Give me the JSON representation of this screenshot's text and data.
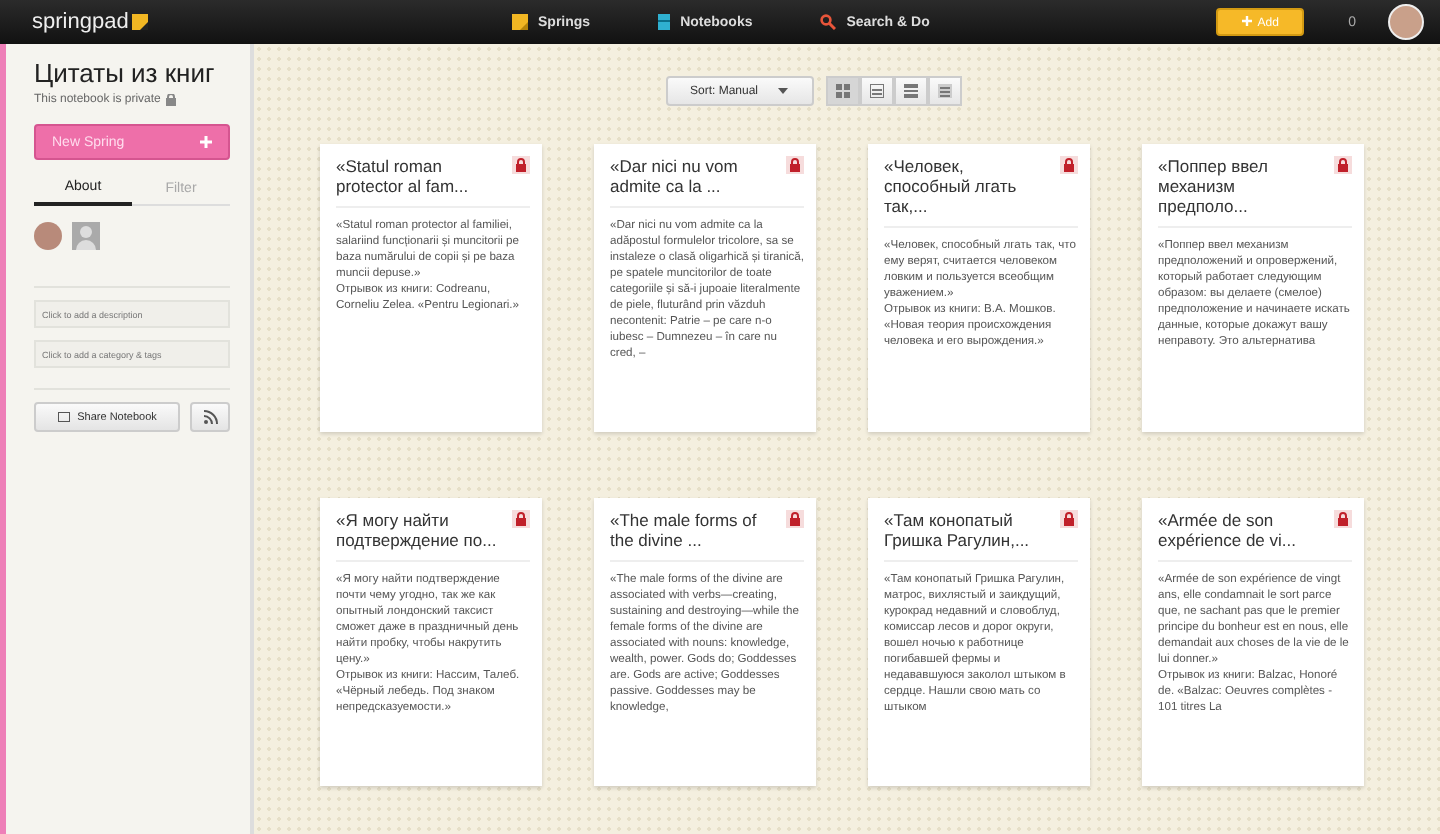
{
  "topbar": {
    "logo": "springpad",
    "nav": [
      {
        "label": "Springs",
        "kind": "springs"
      },
      {
        "label": "Notebooks",
        "kind": "notebooks"
      },
      {
        "label": "Search & Do",
        "kind": "search"
      }
    ],
    "add_button": "Add",
    "count": "0"
  },
  "sidebar": {
    "title": "Цитаты из книг",
    "privacy": "This notebook is private",
    "new_button": "New Spring",
    "tabs": [
      {
        "label": "About",
        "selected": true
      },
      {
        "label": "Filter",
        "selected": false
      }
    ],
    "description_placeholder": "Click to add a description",
    "tags_placeholder": "Click to add a category & tags",
    "share_button": "Share Notebook"
  },
  "toolbar": {
    "sort": "Sort: Manual",
    "view_modes": [
      {
        "kind": "grid",
        "selected": true
      },
      {
        "kind": "list",
        "selected": false
      },
      {
        "kind": "rows",
        "selected": false
      },
      {
        "kind": "compact",
        "selected": false
      }
    ]
  },
  "cards": [
    {
      "title": "«Statul roman protector al fam...",
      "quote": "«Statul roman protector al familiei, salariind funcționarii și muncitorii pe baza numărului de copii și pe baza muncii depuse.»",
      "source": "Отрывок из книги: Codreanu, Corneliu Zelea. «Pentru Legionari.»"
    },
    {
      "title": "«Dar nici nu vom admite ca la ...",
      "quote": "«Dar nici nu vom admite ca la adăpostul formulelor tricolore, sa se instaleze o clasă oligarhică și tiranică, pe spatele muncitorilor de toate categoriile și să-i jupoaie literalmente de piele, fluturând prin văzduh necontenit: Patrie – pe care n-o iubesc – Dumnezeu – în care nu cred, –"
    },
    {
      "title": "«Человек, способный лгать так,...",
      "quote": "«Человек, способный лгать так, что ему верят, считается человеком ловким и пользуется всеобщим уважением.»",
      "source": "Отрывок из книги: В.А. Мошков. «Новая теория происхождения человека и его вырождения.»"
    },
    {
      "title": "«Поппер ввел механизм предполо...",
      "quote": "«Поппер ввел механизм предположений и опровержений, который работает следующим образом: вы делаете (смелое) предположение и начинаете искать данные, которые докажут вашу неправоту. Это альтернатива"
    },
    {
      "title": "«Я могу найти подтверждение по...",
      "quote": "«Я могу найти подтверждение почти чему угодно, так же как опытный лондонский таксист сможет даже в праздничный день найти пробку, чтобы накрутить цену.»",
      "source": "Отрывок из книги: Нассим, Талеб. «Чёрный лебедь. Под знаком непредсказуемости.»"
    },
    {
      "title": "«The male forms of the divine ...",
      "quote": "«The male forms of the divine are associated with verbs—creating, sustaining and destroying—while the female forms of the divine are associated with nouns: knowledge, wealth, power. Gods do; Goddesses are. Gods are active; Goddesses passive. Goddesses may be knowledge,"
    },
    {
      "title": "«Там конопатый Гришка Рагулин,...",
      "quote": "«Там конопатый Гришка Рагулин, матрос, вихлястый и заикдущий, курокрад недавний и словоблуд, комиссар лесов и дорог округи, вошел ночью к работнице погибавшей фермы и недававшуюся заколол штыком в сердце. Нашли свою мать со штыком"
    },
    {
      "title": "«Armée de son expérience de vi...",
      "quote": "«Armée de son expérience de vingt ans, elle condamnait le sort parce que, ne sachant pas que le premier principe du bonheur est en nous, elle demandait aux choses de la vie de le lui donner.»",
      "source": "Отрывок из книги: Balzac, Honoré de. «Balzac: Oeuvres complètes - 101 titres La"
    }
  ]
}
